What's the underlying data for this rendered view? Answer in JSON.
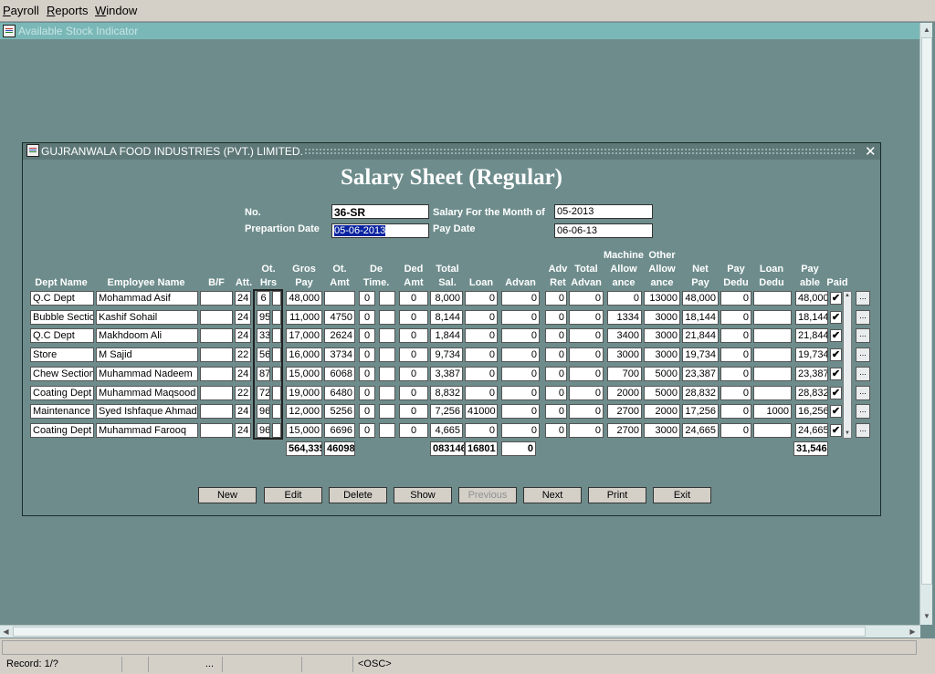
{
  "menu": [
    "Payroll",
    "Reports",
    "Window"
  ],
  "mdi_title": "Available Stock Indicator",
  "form": {
    "title": "GUJRANWALA FOOD INDUSTRIES (PVT.) LIMITED.",
    "heading": "Salary Sheet (Regular)",
    "no_label": "No.",
    "no_value": "36-SR",
    "prep_label": "Prepartion Date",
    "prep_value": "05-06-2013",
    "month_label": "Salary For the Month of",
    "month_value": "05-2013",
    "paydate_label": "Pay Date",
    "paydate_value": "06-06-13"
  },
  "columns": {
    "dept": "Dept Name",
    "emp": "Employee Name",
    "bf": "B/F",
    "att": "Att.",
    "ot1": "Ot.",
    "ot2": "Hrs",
    "gros1": "Gros",
    "gros2": "Pay",
    "otamt1": "Ot.",
    "otamt2": "Amt",
    "de1": "De",
    "de2": "Time.",
    "ded1": "Ded",
    "ded2": "Amt",
    "tot1": "Total",
    "tot2": "Sal.",
    "loan": "Loan",
    "advan": "Advan",
    "adv1": "Adv",
    "adv2": "Ret",
    "ta1": "Total",
    "ta2": "Advan",
    "mach0": "Machine",
    "mach1": "Allow",
    "mach2": "ance",
    "oth0": "Other",
    "oth1": "Allow",
    "oth2": "ance",
    "net1": "Net",
    "net2": "Pay",
    "pd1": "Pay",
    "pd2": "Dedu",
    "ld1": "Loan",
    "ld2": "Dedu",
    "pa1": "Pay",
    "pa2": "able",
    "paid": "Paid"
  },
  "rows": [
    {
      "dept": "Q.C Dept",
      "emp": "Mohammad Asif",
      "bf": "",
      "att": "24",
      "ot": "6",
      "gros": "48,000",
      "otamt": "",
      "de": "0",
      "ded": "0",
      "total": "8,000",
      "loan": "0",
      "advan": "0",
      "advret": "0",
      "totadv": "0",
      "mach": "0",
      "other": "13000",
      "net": "48,000",
      "paydedu": "0",
      "loandedu": "",
      "payable": "48,000",
      "paid": "✔"
    },
    {
      "dept": "Bubble Section",
      "emp": "Kashif Sohail",
      "bf": "",
      "att": "24",
      "ot": "95",
      "gros": "11,000",
      "otamt": "4750",
      "de": "0",
      "ded": "0",
      "total": "8,144",
      "loan": "0",
      "advan": "0",
      "advret": "0",
      "totadv": "0",
      "mach": "1334",
      "other": "3000",
      "net": "18,144",
      "paydedu": "0",
      "loandedu": "",
      "payable": "18,144",
      "paid": "✔"
    },
    {
      "dept": "Q.C Dept",
      "emp": "Makhdoom Ali",
      "bf": "",
      "att": "24",
      "ot": "33",
      "gros": "17,000",
      "otamt": "2624",
      "de": "0",
      "ded": "0",
      "total": "1,844",
      "loan": "0",
      "advan": "0",
      "advret": "0",
      "totadv": "0",
      "mach": "3400",
      "other": "3000",
      "net": "21,844",
      "paydedu": "0",
      "loandedu": "",
      "payable": "21,844",
      "paid": "✔"
    },
    {
      "dept": "Store",
      "emp": "M Sajid",
      "bf": "",
      "att": "22",
      "ot": "56",
      "gros": "16,000",
      "otamt": "3734",
      "de": "0",
      "ded": "0",
      "total": "9,734",
      "loan": "0",
      "advan": "0",
      "advret": "0",
      "totadv": "0",
      "mach": "3000",
      "other": "3000",
      "net": "19,734",
      "paydedu": "0",
      "loandedu": "",
      "payable": "19,734",
      "paid": "✔"
    },
    {
      "dept": "Chew Section",
      "emp": "Muhammad Nadeem",
      "bf": "",
      "att": "24",
      "ot": "87",
      "gros": "15,000",
      "otamt": "6068",
      "de": "0",
      "ded": "0",
      "total": "3,387",
      "loan": "0",
      "advan": "0",
      "advret": "0",
      "totadv": "0",
      "mach": "700",
      "other": "5000",
      "net": "23,387",
      "paydedu": "0",
      "loandedu": "",
      "payable": "23,387",
      "paid": "✔"
    },
    {
      "dept": "Coating Dept",
      "emp": "Muhammad Maqsood",
      "bf": "",
      "att": "22",
      "ot": "72",
      "gros": "19,000",
      "otamt": "6480",
      "de": "0",
      "ded": "0",
      "total": "8,832",
      "loan": "0",
      "advan": "0",
      "advret": "0",
      "totadv": "0",
      "mach": "2000",
      "other": "5000",
      "net": "28,832",
      "paydedu": "0",
      "loandedu": "",
      "payable": "28,832",
      "paid": "✔"
    },
    {
      "dept": "Maintenance Dept",
      "emp": "Syed Ishfaque Ahmad",
      "bf": "",
      "att": "24",
      "ot": "96",
      "gros": "12,000",
      "otamt": "5256",
      "de": "0",
      "ded": "0",
      "total": "7,256",
      "loan": "41000",
      "advan": "0",
      "advret": "0",
      "totadv": "0",
      "mach": "2700",
      "other": "2000",
      "net": "17,256",
      "paydedu": "0",
      "loandedu": "1000",
      "payable": "16,256",
      "paid": "✔"
    },
    {
      "dept": "Coating Dept",
      "emp": "Muhammad Farooq",
      "bf": "",
      "att": "24",
      "ot": "96",
      "gros": "15,000",
      "otamt": "6696",
      "de": "0",
      "ded": "0",
      "total": "4,665",
      "loan": "0",
      "advan": "0",
      "advret": "0",
      "totadv": "0",
      "mach": "2700",
      "other": "3000",
      "net": "24,665",
      "paydedu": "0",
      "loandedu": "",
      "payable": "24,665",
      "paid": "✔"
    }
  ],
  "totals": {
    "gros": "564,335",
    "otamt": "46098",
    "total": "083146",
    "loan": "16801",
    "advan": "0",
    "payable": "31,546"
  },
  "buttons": {
    "new": "New",
    "edit": "Edit",
    "delete": "Delete",
    "show": "Show",
    "previous": "Previous",
    "next": "Next",
    "print": "Print",
    "exit": "Exit"
  },
  "status": {
    "record": "Record: 1/?",
    "dots": "...",
    "osc": "<OSC>"
  }
}
